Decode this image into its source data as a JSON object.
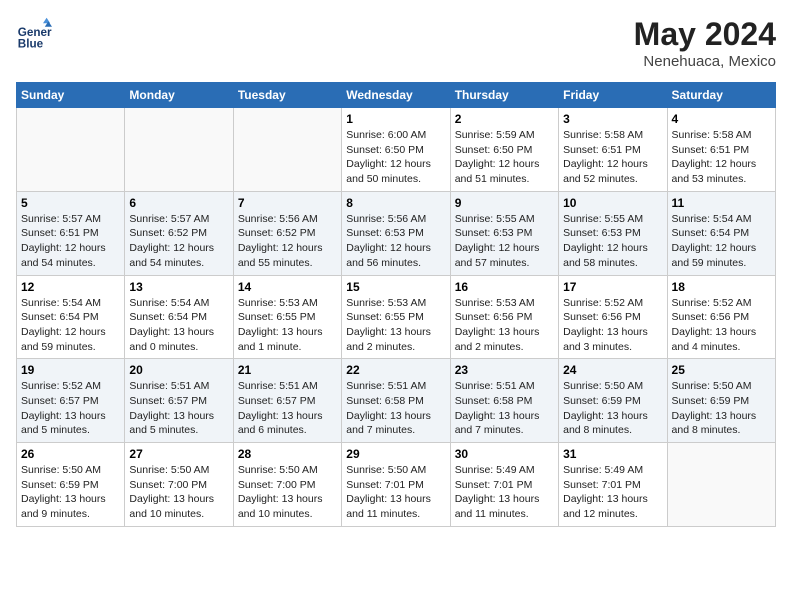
{
  "logo": {
    "line1": "General",
    "line2": "Blue"
  },
  "title": {
    "month": "May 2024",
    "location": "Nenehuaca, Mexico"
  },
  "weekdays": [
    "Sunday",
    "Monday",
    "Tuesday",
    "Wednesday",
    "Thursday",
    "Friday",
    "Saturday"
  ],
  "weeks": [
    [
      {
        "day": "",
        "info": ""
      },
      {
        "day": "",
        "info": ""
      },
      {
        "day": "",
        "info": ""
      },
      {
        "day": "1",
        "info": "Sunrise: 6:00 AM\nSunset: 6:50 PM\nDaylight: 12 hours\nand 50 minutes."
      },
      {
        "day": "2",
        "info": "Sunrise: 5:59 AM\nSunset: 6:50 PM\nDaylight: 12 hours\nand 51 minutes."
      },
      {
        "day": "3",
        "info": "Sunrise: 5:58 AM\nSunset: 6:51 PM\nDaylight: 12 hours\nand 52 minutes."
      },
      {
        "day": "4",
        "info": "Sunrise: 5:58 AM\nSunset: 6:51 PM\nDaylight: 12 hours\nand 53 minutes."
      }
    ],
    [
      {
        "day": "5",
        "info": "Sunrise: 5:57 AM\nSunset: 6:51 PM\nDaylight: 12 hours\nand 54 minutes."
      },
      {
        "day": "6",
        "info": "Sunrise: 5:57 AM\nSunset: 6:52 PM\nDaylight: 12 hours\nand 54 minutes."
      },
      {
        "day": "7",
        "info": "Sunrise: 5:56 AM\nSunset: 6:52 PM\nDaylight: 12 hours\nand 55 minutes."
      },
      {
        "day": "8",
        "info": "Sunrise: 5:56 AM\nSunset: 6:53 PM\nDaylight: 12 hours\nand 56 minutes."
      },
      {
        "day": "9",
        "info": "Sunrise: 5:55 AM\nSunset: 6:53 PM\nDaylight: 12 hours\nand 57 minutes."
      },
      {
        "day": "10",
        "info": "Sunrise: 5:55 AM\nSunset: 6:53 PM\nDaylight: 12 hours\nand 58 minutes."
      },
      {
        "day": "11",
        "info": "Sunrise: 5:54 AM\nSunset: 6:54 PM\nDaylight: 12 hours\nand 59 minutes."
      }
    ],
    [
      {
        "day": "12",
        "info": "Sunrise: 5:54 AM\nSunset: 6:54 PM\nDaylight: 12 hours\nand 59 minutes."
      },
      {
        "day": "13",
        "info": "Sunrise: 5:54 AM\nSunset: 6:54 PM\nDaylight: 13 hours\nand 0 minutes."
      },
      {
        "day": "14",
        "info": "Sunrise: 5:53 AM\nSunset: 6:55 PM\nDaylight: 13 hours\nand 1 minute."
      },
      {
        "day": "15",
        "info": "Sunrise: 5:53 AM\nSunset: 6:55 PM\nDaylight: 13 hours\nand 2 minutes."
      },
      {
        "day": "16",
        "info": "Sunrise: 5:53 AM\nSunset: 6:56 PM\nDaylight: 13 hours\nand 2 minutes."
      },
      {
        "day": "17",
        "info": "Sunrise: 5:52 AM\nSunset: 6:56 PM\nDaylight: 13 hours\nand 3 minutes."
      },
      {
        "day": "18",
        "info": "Sunrise: 5:52 AM\nSunset: 6:56 PM\nDaylight: 13 hours\nand 4 minutes."
      }
    ],
    [
      {
        "day": "19",
        "info": "Sunrise: 5:52 AM\nSunset: 6:57 PM\nDaylight: 13 hours\nand 5 minutes."
      },
      {
        "day": "20",
        "info": "Sunrise: 5:51 AM\nSunset: 6:57 PM\nDaylight: 13 hours\nand 5 minutes."
      },
      {
        "day": "21",
        "info": "Sunrise: 5:51 AM\nSunset: 6:57 PM\nDaylight: 13 hours\nand 6 minutes."
      },
      {
        "day": "22",
        "info": "Sunrise: 5:51 AM\nSunset: 6:58 PM\nDaylight: 13 hours\nand 7 minutes."
      },
      {
        "day": "23",
        "info": "Sunrise: 5:51 AM\nSunset: 6:58 PM\nDaylight: 13 hours\nand 7 minutes."
      },
      {
        "day": "24",
        "info": "Sunrise: 5:50 AM\nSunset: 6:59 PM\nDaylight: 13 hours\nand 8 minutes."
      },
      {
        "day": "25",
        "info": "Sunrise: 5:50 AM\nSunset: 6:59 PM\nDaylight: 13 hours\nand 8 minutes."
      }
    ],
    [
      {
        "day": "26",
        "info": "Sunrise: 5:50 AM\nSunset: 6:59 PM\nDaylight: 13 hours\nand 9 minutes."
      },
      {
        "day": "27",
        "info": "Sunrise: 5:50 AM\nSunset: 7:00 PM\nDaylight: 13 hours\nand 10 minutes."
      },
      {
        "day": "28",
        "info": "Sunrise: 5:50 AM\nSunset: 7:00 PM\nDaylight: 13 hours\nand 10 minutes."
      },
      {
        "day": "29",
        "info": "Sunrise: 5:50 AM\nSunset: 7:01 PM\nDaylight: 13 hours\nand 11 minutes."
      },
      {
        "day": "30",
        "info": "Sunrise: 5:49 AM\nSunset: 7:01 PM\nDaylight: 13 hours\nand 11 minutes."
      },
      {
        "day": "31",
        "info": "Sunrise: 5:49 AM\nSunset: 7:01 PM\nDaylight: 13 hours\nand 12 minutes."
      },
      {
        "day": "",
        "info": ""
      }
    ]
  ]
}
